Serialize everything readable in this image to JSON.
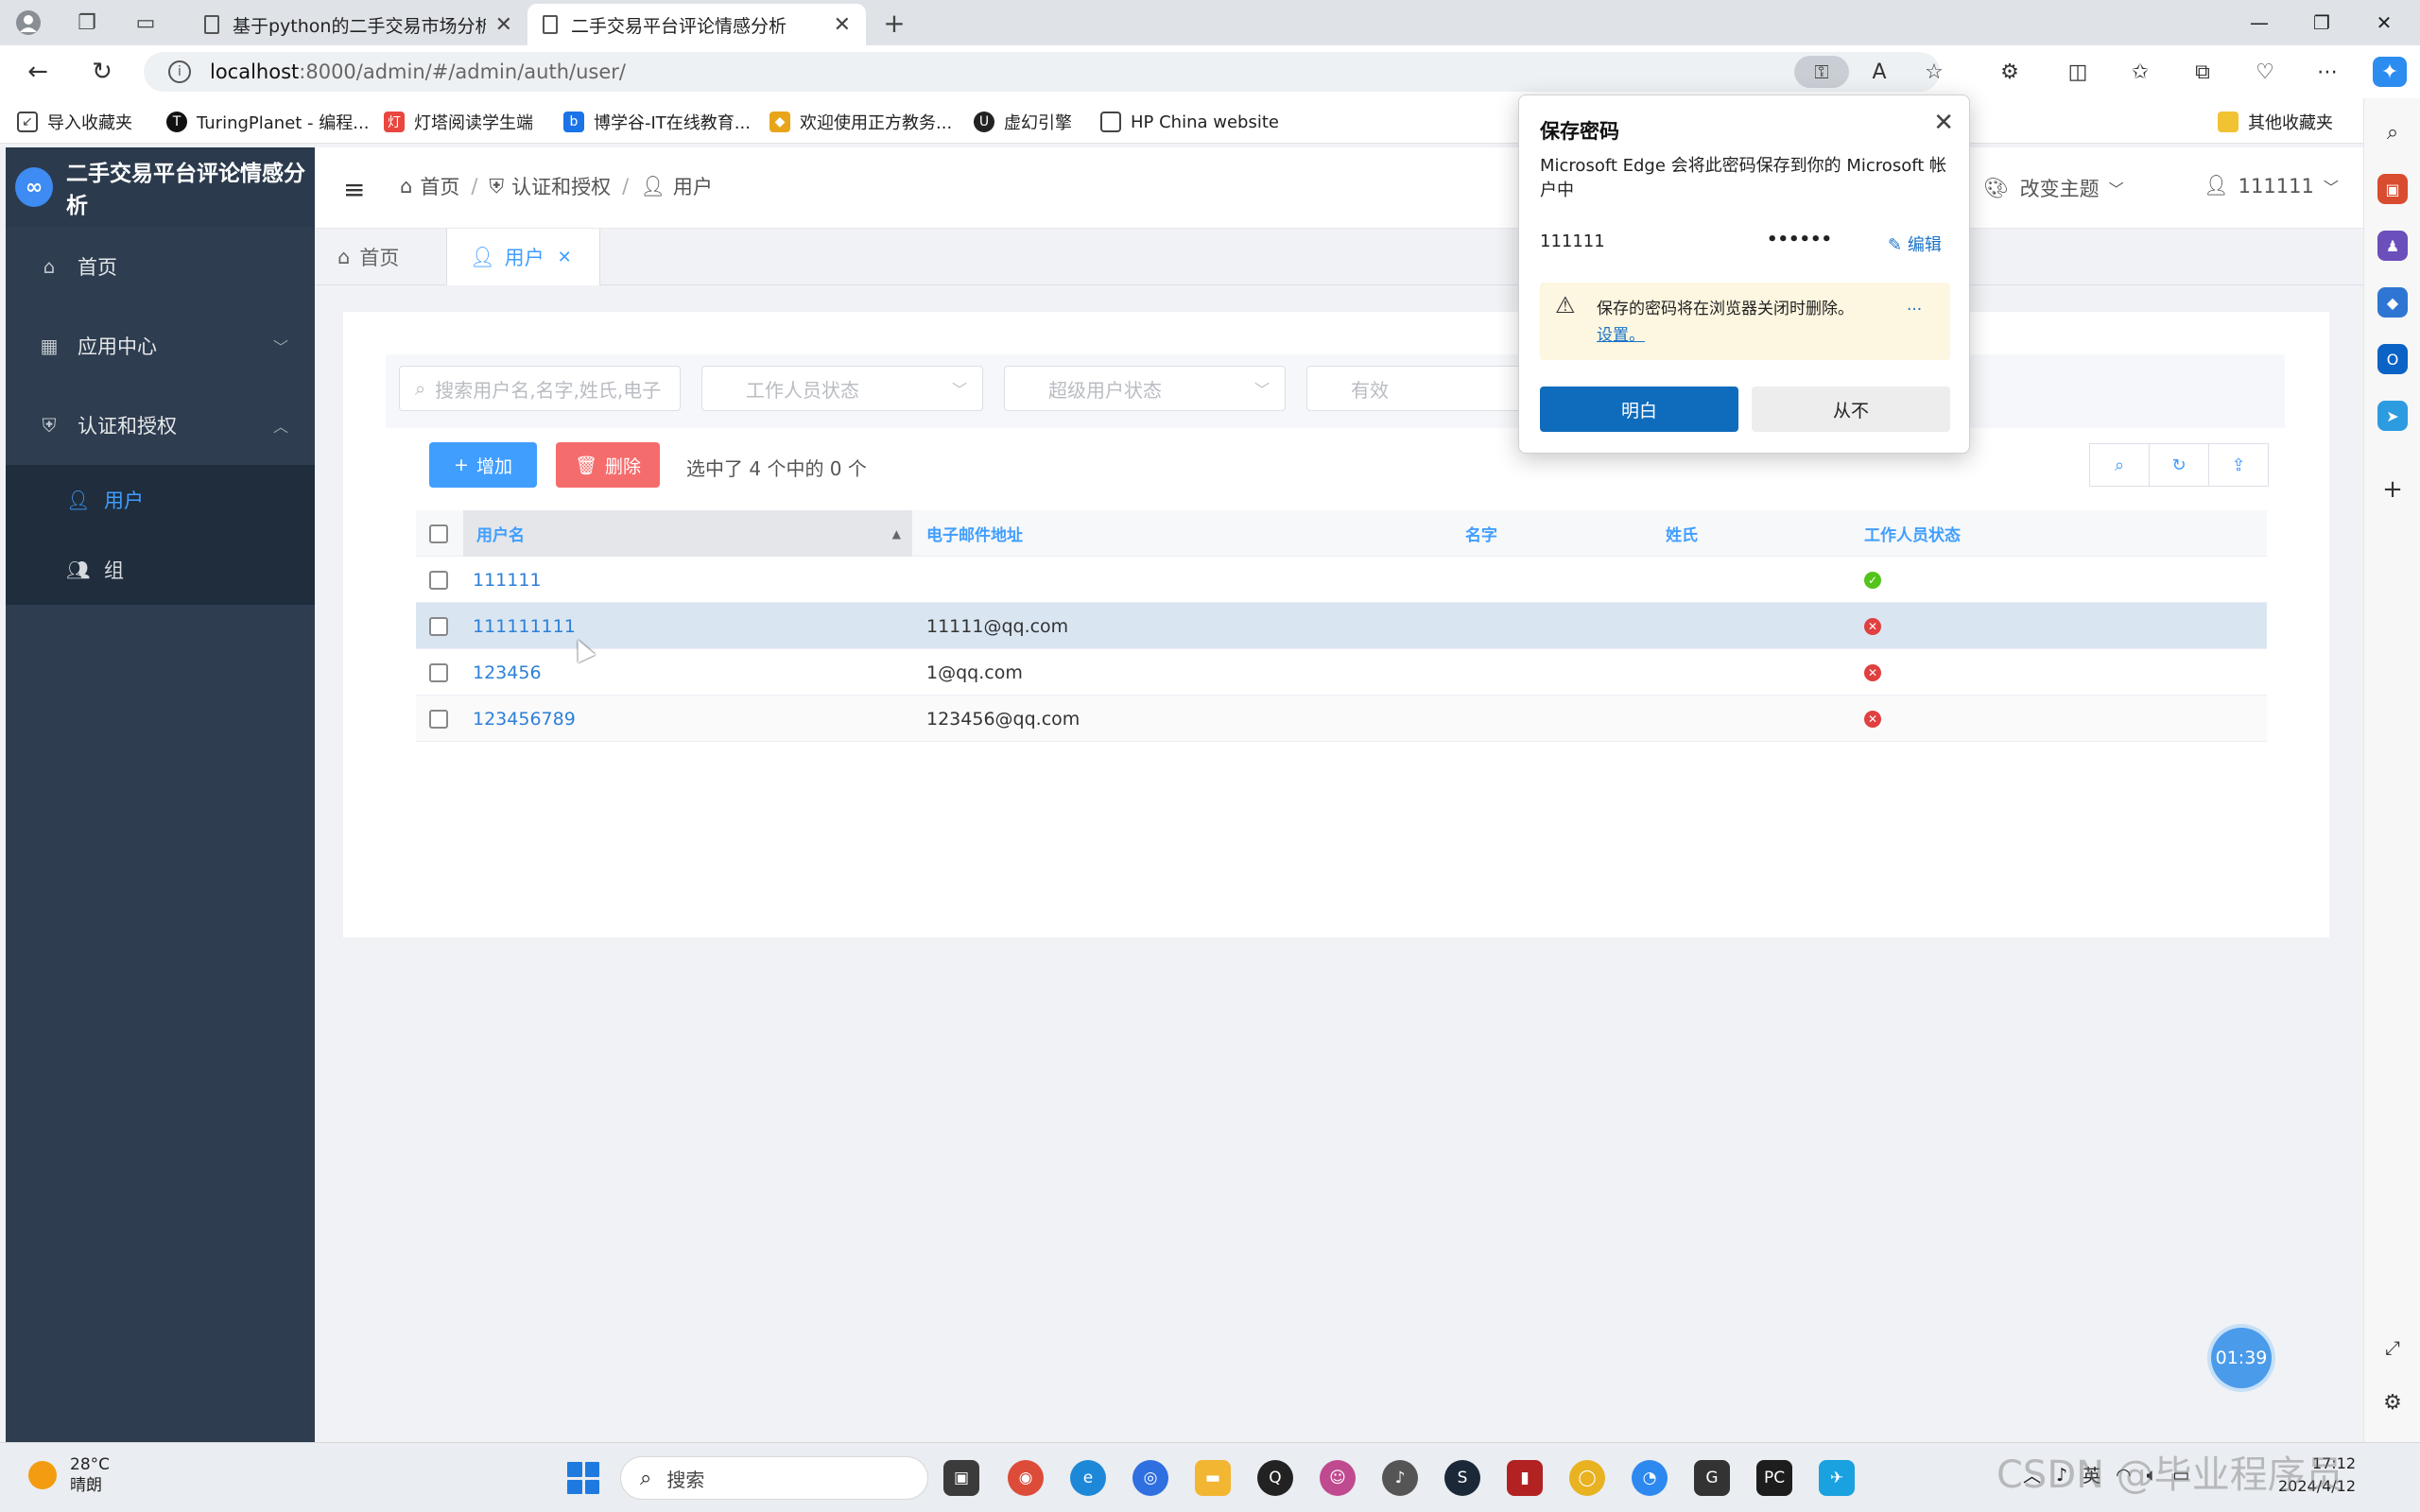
{
  "browser": {
    "tabs": [
      {
        "title": "基于python的二手交易市场分析",
        "active": false
      },
      {
        "title": "二手交易平台评论情感分析",
        "active": true
      }
    ],
    "url_host": "localhost",
    "url_path": ":8000/admin/#/admin/auth/user/",
    "bookmarks": [
      "导入收藏夹",
      "TuringPlanet - 编程...",
      "灯塔阅读学生端",
      "博学谷-IT在线教育...",
      "欢迎使用正方教务...",
      "虚幻引擎",
      "HP China website",
      "其他收藏夹"
    ]
  },
  "app": {
    "title": "二手交易平台评论情感分析",
    "menu": {
      "home": "首页",
      "app_center": "应用中心",
      "auth": "认证和授权",
      "users": "用户",
      "groups": "组"
    },
    "breadcrumb": [
      "首页",
      "认证和授权",
      "用户"
    ],
    "theme_label": "改变主题",
    "current_user": "111111",
    "page_tabs": [
      {
        "label": "首页",
        "active": false
      },
      {
        "label": "用户",
        "active": true
      }
    ]
  },
  "filters": {
    "search_placeholder": "搜索用户名,名字,姓氏,电子",
    "staff_status": "工作人员状态",
    "superuser_status": "超级用户状态",
    "active": "有效"
  },
  "toolbar": {
    "add_label": "增加",
    "delete_label": "删除",
    "selection_info": "选中了 4 个中的 0 个"
  },
  "table": {
    "columns": [
      "用户名",
      "电子邮件地址",
      "名字",
      "姓氏",
      "工作人员状态"
    ],
    "rows": [
      {
        "username": "111111",
        "email": "",
        "first_name": "",
        "last_name": "",
        "is_staff": true
      },
      {
        "username": "111111111",
        "email": "11111@qq.com",
        "first_name": "",
        "last_name": "",
        "is_staff": false
      },
      {
        "username": "123456",
        "email": "1@qq.com",
        "first_name": "",
        "last_name": "",
        "is_staff": false
      },
      {
        "username": "123456789",
        "email": "123456@qq.com",
        "first_name": "",
        "last_name": "",
        "is_staff": false
      }
    ]
  },
  "password_popup": {
    "title": "保存密码",
    "description": "Microsoft Edge 会将此密码保存到你的 Microsoft 帐户中",
    "username": "111111",
    "password_mask": "••••••",
    "edit_label": "编辑",
    "warning_text": "保存的密码将在浏览器关闭时删除。",
    "settings_link": "设置。",
    "more": "...",
    "ok_label": "明白",
    "never_label": "从不"
  },
  "timer": "01:39",
  "taskbar": {
    "temperature": "28°C",
    "weather": "晴朗",
    "search_placeholder": "搜索",
    "ime": "英",
    "time": "17:12",
    "date": "2024/4/12"
  },
  "watermark": "CSDN @毕业程序员",
  "colors": {
    "sidebar_bg": "#2e3d4f",
    "primary": "#409eff",
    "add_button": "#409eff",
    "delete_button": "#f56c6c",
    "ok_status": "#52c41a",
    "no_status": "#e04040"
  }
}
